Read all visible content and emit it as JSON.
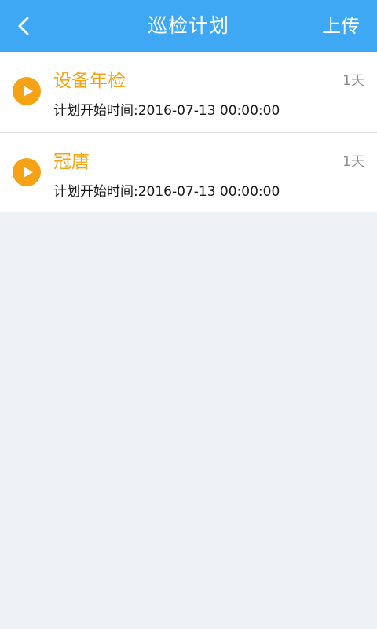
{
  "header": {
    "title": "巡检计划",
    "upload_label": "上传",
    "background_color": "#3ea8f4"
  },
  "plans": [
    {
      "name": "设备年检",
      "start_time": "计划开始时间:2016-07-13 00:00:00",
      "duration": "1天",
      "icon": "play-icon"
    },
    {
      "name": "冠唐",
      "start_time": "计划开始时间:2016-07-13 00:00:00",
      "duration": "1天",
      "icon": "play-icon"
    }
  ],
  "colors": {
    "accent": "#f5a214",
    "page_background": "#eef2f5"
  }
}
